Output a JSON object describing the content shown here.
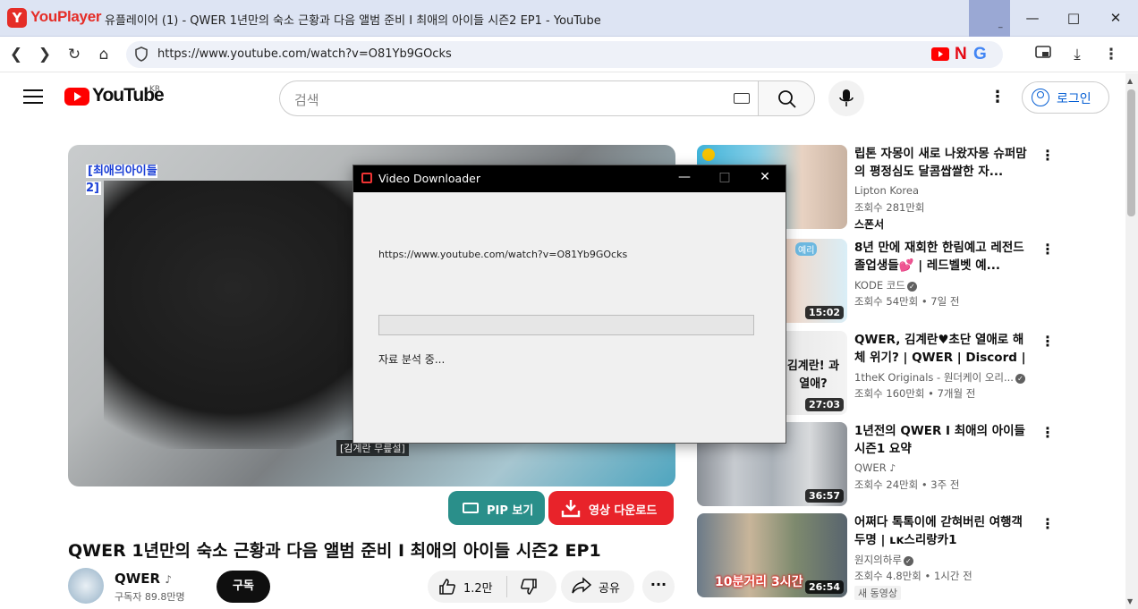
{
  "browser": {
    "app_name": "YouPlayer",
    "app_logo_letter": "Y",
    "window_title": "유플레이어 (1) - QWER 1년만의 숙소 근황과 다음 앨범 준비 I 최애의 아이들 시즌2 EP1 - YouTube",
    "url": "https://www.youtube.com/watch?v=O81Yb9GOcks",
    "ext_n": "N",
    "ext_g": "G",
    "min_glyph": "_"
  },
  "youtube": {
    "logo_text": "YouTube",
    "region": "KR",
    "search_placeholder": "검색",
    "login_label": "로그인"
  },
  "player": {
    "overlay_logo": "[최애의아이들2]",
    "subtitle": "[김계란 무릎설]",
    "pip_label": "PIP 보기",
    "download_label": "영상 다운로드"
  },
  "video": {
    "title": "QWER 1년만의 숙소 근황과 다음 앨범 준비 I 최애의 아이들 시즌2 EP1",
    "channel": "QWER",
    "subscribers": "구독자 89.8만명",
    "subscribe_label": "구독",
    "likes": "1.2만",
    "share_label": "공유"
  },
  "recommendations": [
    {
      "title": "립톤 자몽이 새로 나왔자몽 슈퍼맘의 평정심도 달콤쌉쌀한 자...",
      "channel": "Lipton Korea",
      "meta": "조회수 281만회",
      "badge": "스폰서",
      "duration": ""
    },
    {
      "title": "8년 만에 재회한 한림예고 레전드 졸업생들💕 | 레드벨벳 예...",
      "channel": "KODE 코드",
      "meta": "조회수 54만회 • 7일 전",
      "badge": "",
      "duration": "15:02",
      "thumb_text": "예리"
    },
    {
      "title": "QWER, 김계란♥초단 열애로 해체 위기? | QWER | Discord | 본...",
      "channel": "1theK Originals - 원더케이 오리...",
      "meta": "조회수 160만회 • 7개월 전",
      "badge": "",
      "duration": "27:03",
      "thumb_text": "김계란! 과 열애?"
    },
    {
      "title": "1년전의 QWER I 최애의 아이들 시즌1 요약",
      "channel": "QWER",
      "meta": "조회수 24만회 • 3주 전",
      "badge": "",
      "duration": "36:57"
    },
    {
      "title": "어쩌다 톡톡이에 갇혀버린 여행객 두명 | ʟᴋ스리랑카1",
      "channel": "원지의하루",
      "meta": "조회수 4.8만회 • 1시간 전",
      "badge": "새 동영상",
      "duration": "26:54",
      "thumb_text": "10분거리 3시간"
    }
  ],
  "dialog": {
    "title": "Video Downloader",
    "url": "https://www.youtube.com/watch?v=O81Yb9GOcks",
    "status": "자료 분석 중...",
    "progress": 0
  }
}
